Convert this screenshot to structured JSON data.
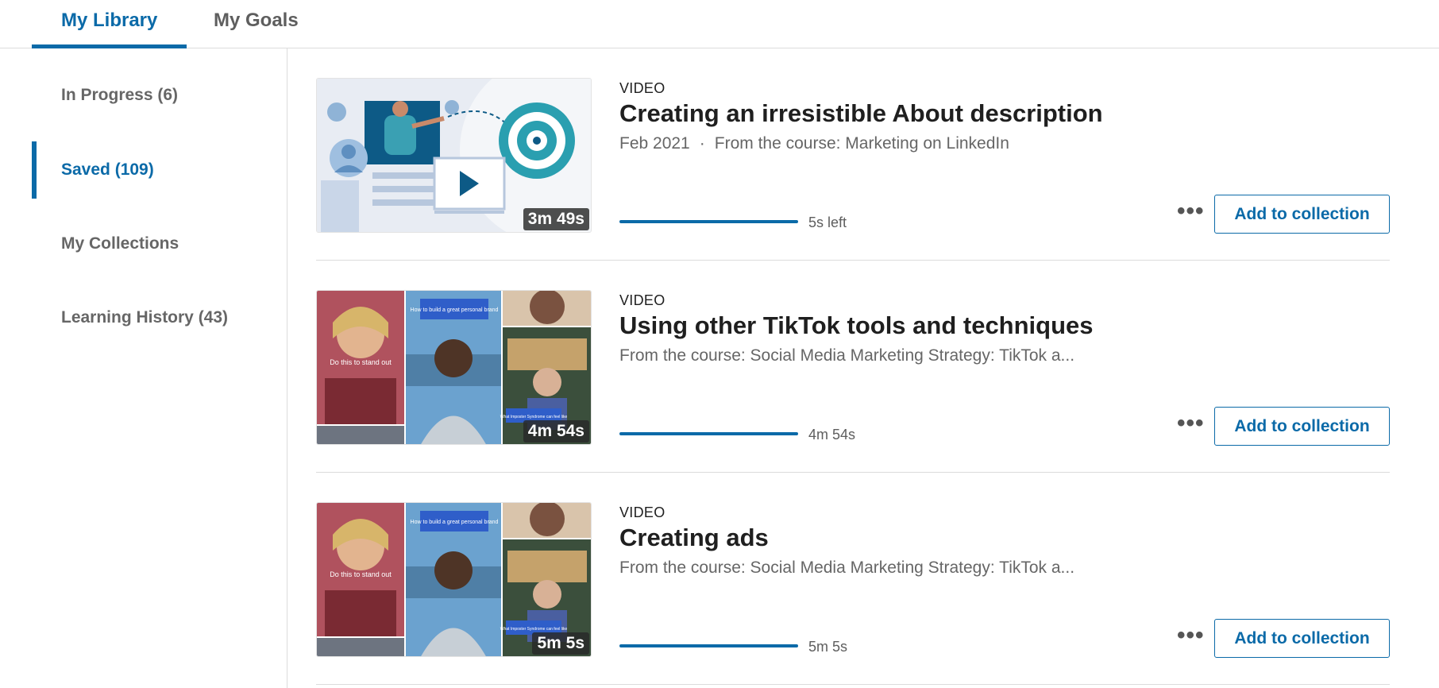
{
  "tabs": [
    {
      "label": "My Library",
      "active": true
    },
    {
      "label": "My Goals",
      "active": false
    }
  ],
  "sidebar": {
    "items": [
      {
        "label": "In Progress (6)",
        "active": false
      },
      {
        "label": "Saved (109)",
        "active": true
      },
      {
        "label": "My Collections",
        "active": false
      },
      {
        "label": "Learning History (43)",
        "active": false
      }
    ]
  },
  "items": [
    {
      "type": "VIDEO",
      "title": "Creating an irresistible About description",
      "date": "Feb 2021",
      "separator": "·",
      "course": "From the course: Marketing on LinkedIn",
      "duration": "3m 49s",
      "remaining": "5s left",
      "progress": 1.0,
      "more_icon": "ellipsis-icon",
      "more_label": "•••",
      "add_label": "Add to collection"
    },
    {
      "type": "VIDEO",
      "title": "Using other TikTok tools and techniques",
      "course": "From the course: Social Media Marketing Strategy: TikTok a...",
      "duration": "4m 54s",
      "remaining": "4m 54s",
      "progress": 1.0,
      "thumb_text": [
        "Do this to stand out",
        "How to build a great personal brand",
        "What Imposter Syndrome can feel like"
      ],
      "more_icon": "ellipsis-icon",
      "more_label": "•••",
      "add_label": "Add to collection"
    },
    {
      "type": "VIDEO",
      "title": "Creating ads",
      "course": "From the course: Social Media Marketing Strategy: TikTok a...",
      "duration": "5m 5s",
      "remaining": "5m 5s",
      "progress": 1.0,
      "thumb_text": [
        "Do this to stand out",
        "How to build a great personal brand",
        "What Imposter Syndrome can feel like"
      ],
      "more_icon": "ellipsis-icon",
      "more_label": "•••",
      "add_label": "Add to collection"
    }
  ],
  "colors": {
    "accent": "#0b6aa8",
    "text": "#1f1f1f",
    "muted": "#666666",
    "divider": "#dcdcdc"
  }
}
